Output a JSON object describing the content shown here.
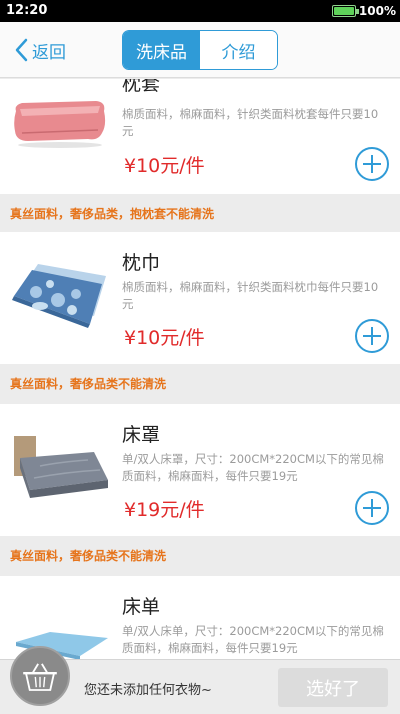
{
  "status": {
    "time": "12:20",
    "battery": "100%"
  },
  "nav": {
    "back_label": "返回",
    "tabs": [
      {
        "label": "洗床品",
        "active": true
      },
      {
        "label": "介绍",
        "active": false
      }
    ]
  },
  "items": [
    {
      "name": "枕套",
      "desc": "棉质面料，棉麻面料，针织类面料枕套每件只要10元",
      "price": "¥10元/件",
      "note": "真丝面料，奢侈品类，抱枕套不能清洗"
    },
    {
      "name": "枕巾",
      "desc": "棉质面料，棉麻面料，针织类面料枕巾每件只要10元",
      "price": "¥10元/件",
      "note": "真丝面料，奢侈品类不能清洗"
    },
    {
      "name": "床罩",
      "desc": "单/双人床罩，尺寸：200CM*220CM以下的常见棉质面料，棉麻面料，每件只要19元",
      "price": "¥19元/件",
      "note": "真丝面料，奢侈品类不能清洗"
    },
    {
      "name": "床单",
      "desc": "单/双人床单，尺寸：200CM*220CM以下的常见棉质面料，棉麻面料，每件只要19元"
    }
  ],
  "bottom": {
    "empty_text": "您还未添加任何衣物~",
    "done_label": "选好了"
  },
  "colors": {
    "accent": "#2f9bd7",
    "price": "#e12b2b",
    "note": "#e6751d"
  },
  "icons": [
    "back-chevron-icon",
    "add-circle-icon",
    "basket-icon"
  ]
}
